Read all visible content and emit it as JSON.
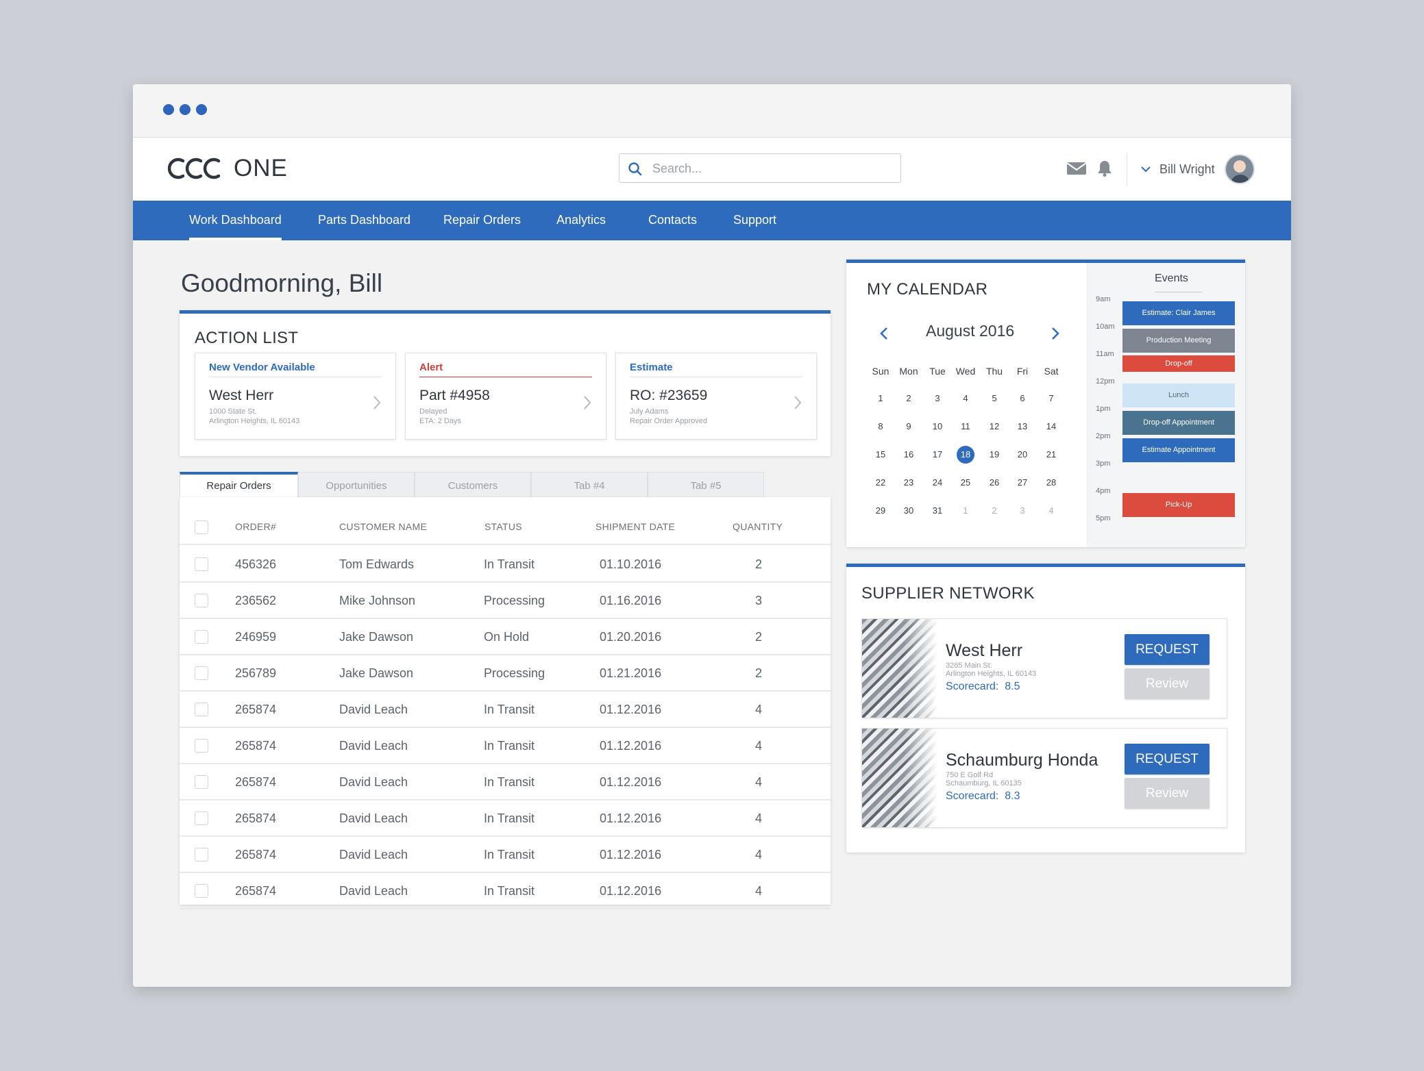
{
  "app": {
    "logo_text": "ONE"
  },
  "search": {
    "placeholder": "Search..."
  },
  "user": {
    "name": "Bill Wright"
  },
  "nav": [
    "Work Dashboard",
    "Parts Dashboard",
    "Repair Orders",
    "Analytics",
    "Contacts",
    "Support"
  ],
  "greeting": "Goodmorning, Bill",
  "action_list": {
    "title": "ACTION LIST",
    "items": [
      {
        "tag": "New Vendor Available",
        "tag_color": "#2e6bbd",
        "main": "West Herr",
        "sub1": "1000 State St.",
        "sub2": "Arlington Heights, IL 60143"
      },
      {
        "tag": "Alert",
        "tag_color": "#c9403b",
        "main": "Part #4958",
        "sub1": "Delayed",
        "sub2": "ETA: 2 Days"
      },
      {
        "tag": "Estimate",
        "tag_color": "#2e6bbd",
        "main": "RO: #23659",
        "sub1": "July Adams",
        "sub2": "Repair Order Approved"
      }
    ]
  },
  "tabs": [
    "Repair Orders",
    "Opportunities",
    "Customers",
    "Tab #4",
    "Tab #5"
  ],
  "table": {
    "columns": [
      "ORDER#",
      "CUSTOMER NAME",
      "STATUS",
      "SHIPMENT DATE",
      "QUANTITY"
    ],
    "rows": [
      [
        "456326",
        "Tom Edwards",
        "In Transit",
        "01.10.2016",
        "2"
      ],
      [
        "236562",
        "Mike Johnson",
        "Processing",
        "01.16.2016",
        "3"
      ],
      [
        "246959",
        "Jake Dawson",
        "On Hold",
        "01.20.2016",
        "2"
      ],
      [
        "256789",
        "Jake Dawson",
        "Processing",
        "01.21.2016",
        "2"
      ],
      [
        "265874",
        "David Leach",
        "In Transit",
        "01.12.2016",
        "4"
      ],
      [
        "265874",
        "David Leach",
        "In Transit",
        "01.12.2016",
        "4"
      ],
      [
        "265874",
        "David Leach",
        "In Transit",
        "01.12.2016",
        "4"
      ],
      [
        "265874",
        "David Leach",
        "In Transit",
        "01.12.2016",
        "4"
      ],
      [
        "265874",
        "David Leach",
        "In Transit",
        "01.12.2016",
        "4"
      ],
      [
        "265874",
        "David Leach",
        "In Transit",
        "01.12.2016",
        "4"
      ]
    ]
  },
  "calendar": {
    "title": "MY CALENDAR",
    "month": "August 2016",
    "weekdays": [
      "Sun",
      "Mon",
      "Tue",
      "Wed",
      "Thu",
      "Fri",
      "Sat"
    ],
    "weeks": [
      [
        "1",
        "2",
        "3",
        "4",
        "5",
        "6",
        "7"
      ],
      [
        "8",
        "9",
        "10",
        "11",
        "12",
        "13",
        "14"
      ],
      [
        "15",
        "16",
        "17",
        "18",
        "19",
        "20",
        "21"
      ],
      [
        "22",
        "23",
        "24",
        "25",
        "26",
        "27",
        "28"
      ],
      [
        "29",
        "30",
        "31",
        "1",
        "2",
        "3",
        "4"
      ]
    ],
    "selected_day": "18",
    "events_title": "Events",
    "hours": [
      "9am",
      "10am",
      "11am",
      "12pm",
      "1pm",
      "2pm",
      "3pm",
      "4pm",
      "5pm"
    ],
    "events": [
      {
        "label": "Estimate: Clair James",
        "color": "#2e6bbd",
        "slot": 0
      },
      {
        "label": "Production Meeting",
        "color": "#7d8590",
        "slot": 1
      },
      {
        "label": "Drop-off",
        "color": "#db4c3f",
        "slot": 2
      },
      {
        "label": "Lunch",
        "color": "#cfe4f5",
        "slot": 3
      },
      {
        "label": "Drop-off Appointment",
        "color": "#4a7390",
        "slot": 4
      },
      {
        "label": "Estimate Appointment",
        "color": "#2e6bbd",
        "slot": 5
      },
      {
        "label": "Pick-Up",
        "color": "#db4c3f",
        "slot": 7
      }
    ]
  },
  "suppliers": {
    "title": "SUPPLIER NETWORK",
    "items": [
      {
        "name": "West Herr",
        "addr1": "3265 Main St.",
        "addr2": "Arlington Heights, IL 60143",
        "score_label": "Scorecard:",
        "score": "8.5",
        "request": "REQUEST",
        "review": "Review"
      },
      {
        "name": "Schaumburg Honda",
        "addr1": "750 E Golf Rd",
        "addr2": "Schaumburg, IL 60135",
        "score_label": "Scorecard:",
        "score": "8.3",
        "request": "REQUEST",
        "review": "Review"
      }
    ]
  }
}
